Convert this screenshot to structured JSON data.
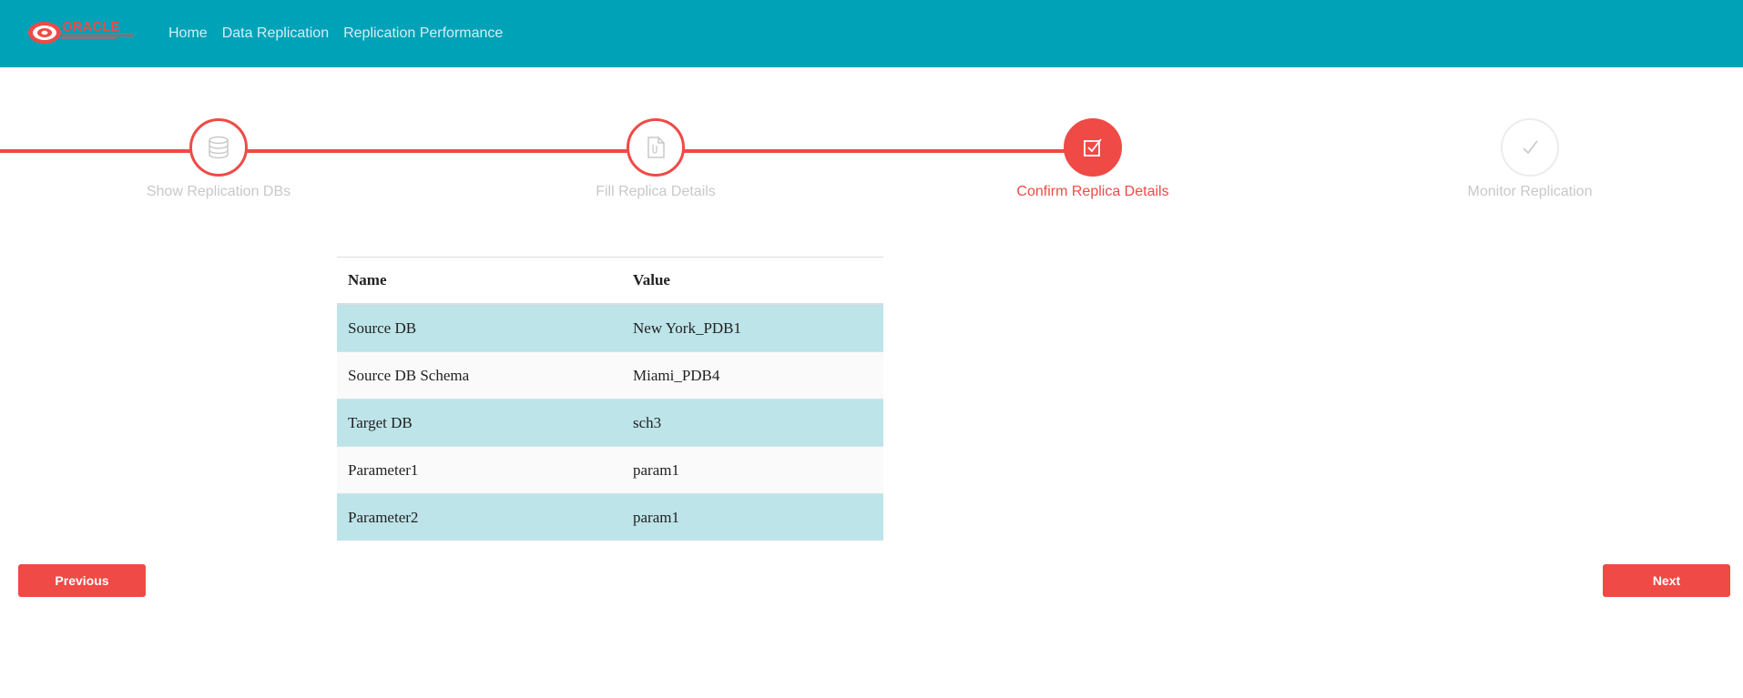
{
  "navbar": {
    "brand": "ORACLE",
    "links": [
      "Home",
      "Data Replication",
      "Replication Performance"
    ]
  },
  "stepper": {
    "steps": [
      {
        "label": "Show Replication DBs",
        "status": "done",
        "icon": "database-icon"
      },
      {
        "label": "Fill Replica Details",
        "status": "done",
        "icon": "document-icon"
      },
      {
        "label": "Confirm Replica Details",
        "status": "active",
        "icon": "checkbox-icon"
      },
      {
        "label": "Monitor Replication",
        "status": "todo",
        "icon": "checkmark-icon"
      }
    ]
  },
  "table": {
    "headers": [
      "Name",
      "Value"
    ],
    "rows": [
      [
        "Source DB",
        "New York_PDB1"
      ],
      [
        "Source DB Schema",
        "Miami_PDB4"
      ],
      [
        "Target DB",
        "sch3"
      ],
      [
        "Parameter1",
        "param1"
      ],
      [
        "Parameter2",
        "param1"
      ]
    ]
  },
  "buttons": {
    "previous": "Previous",
    "next": "Next"
  },
  "colors": {
    "navbar": "#00a2b8",
    "accent": "#ef4a46",
    "row_highlight": "#bde4e9",
    "inactive_text": "#c8c8c8"
  }
}
